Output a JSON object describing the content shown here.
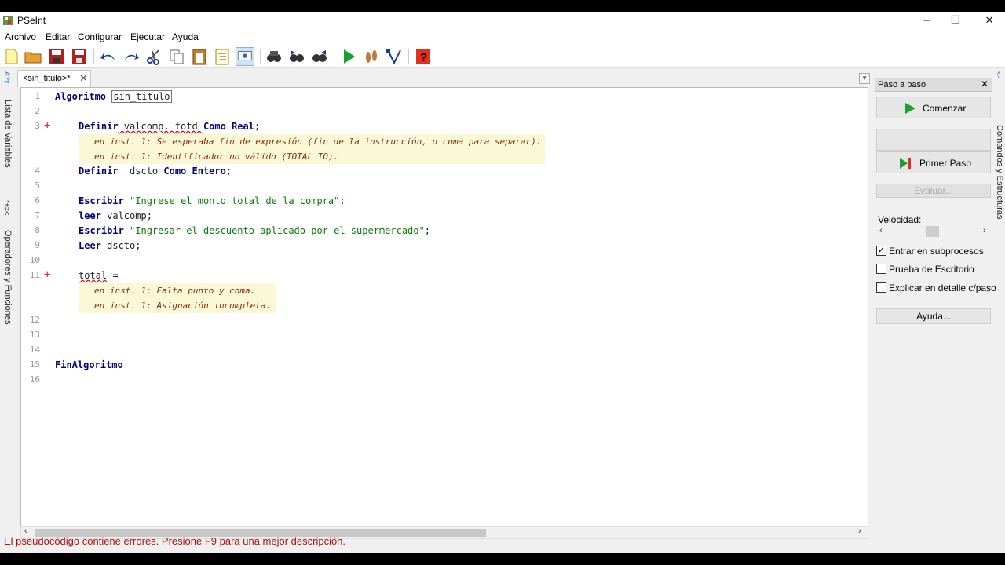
{
  "window": {
    "title": "PSeInt"
  },
  "menu": [
    "Archivo",
    "Editar",
    "Configurar",
    "Ejecutar",
    "Ayuda"
  ],
  "toolbar": {
    "icons": [
      "new-file-icon",
      "open-folder-icon",
      "save-icon",
      "save-as-icon",
      "undo-icon",
      "redo-icon",
      "cut-icon",
      "copy-icon",
      "paste-icon",
      "indent-icon",
      "inspect-icon",
      "search-icon",
      "find-next-icon",
      "find-prev-icon",
      "run-icon",
      "step-icon",
      "diagram-icon",
      "help-icon"
    ]
  },
  "left_sidebar": {
    "variables": "Lista de Variables",
    "operators": "Operadores y Funciones"
  },
  "right_sidebar": {
    "commands": "Comandos y Estructuras"
  },
  "tab": {
    "label": "<sin_titulo>*",
    "close": "✕"
  },
  "editor": {
    "lines": {
      "l1": {
        "num": "1",
        "kw1": "Algoritmo",
        "name": "sin_titulo"
      },
      "l2": {
        "num": "2"
      },
      "l3": {
        "num": "3",
        "mark": "+",
        "kw1": "Definir",
        "text": " valcomp, totd ",
        "kw2": "Como Real",
        "end": ";"
      },
      "l3_err1": "en inst. 1: Se esperaba fin de expresión (fin de la instrucción, o coma para separar).",
      "l3_err2": "en inst. 1: Identificador no válido (TOTAL TO).",
      "l4": {
        "num": "4",
        "kw1": "Definir",
        "text": "  dscto ",
        "kw2": "Como Entero",
        "end": ";"
      },
      "l5": {
        "num": "5"
      },
      "l6": {
        "num": "6",
        "kw1": "Escribir",
        "str": "\"Ingrese el monto total de la compra\"",
        "end": ";"
      },
      "l7": {
        "num": "7",
        "kw1": "leer",
        "text": " valcomp;"
      },
      "l8": {
        "num": "8",
        "kw1": "Escribir",
        "str": "\"Ingresar el descuento aplicado por el supermercado\"",
        "end": ";"
      },
      "l9": {
        "num": "9",
        "kw1": "Leer",
        "text": " dscto;"
      },
      "l10": {
        "num": "10"
      },
      "l11": {
        "num": "11",
        "mark": "+",
        "text": "total",
        "end": " ="
      },
      "l11_err1": "en inst. 1: Falta punto y coma.",
      "l11_err2": "en inst. 1: Asignación incompleta.",
      "l12": {
        "num": "12"
      },
      "l13": {
        "num": "13"
      },
      "l14": {
        "num": "14"
      },
      "l15": {
        "num": "15",
        "kw1": "FinAlgoritmo"
      },
      "l16": {
        "num": "16"
      }
    }
  },
  "status": "El pseudocódigo contiene errores. Presione F9 para una mejor descripción.",
  "panel": {
    "title": "Paso a paso",
    "start": "Comenzar",
    "first_step": "Primer Paso",
    "evaluate": "Evaluar...",
    "speed": "Velocidad:",
    "chk_sub": "Entrar en subprocesos",
    "chk_desk": "Prueba de Escritorio",
    "chk_detail": "Explicar en detalle c/paso",
    "help": "Ayuda..."
  }
}
